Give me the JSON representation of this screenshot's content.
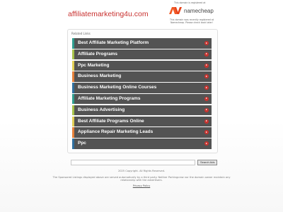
{
  "header": {
    "domain": "affiliatemarketing4u.com",
    "registrar_note": "This domain is registered at",
    "registrar_name": "namecheap",
    "registration_message": "This domain was recently registered at Namecheap. Please check back later!"
  },
  "related": {
    "label": "Related Links",
    "links": [
      {
        "label": "Best Affiliate Marketing Platform",
        "accent": "#2f9e8f"
      },
      {
        "label": "Affiliate Programs",
        "accent": "#a7c34a"
      },
      {
        "label": "Ppc Marketing",
        "accent": "#e1cf55"
      },
      {
        "label": "Business Marketing",
        "accent": "#e6813a"
      },
      {
        "label": "Business Marketing Online Courses",
        "accent": "#2f6f9e"
      },
      {
        "label": "Affiliate Marketing Programs",
        "accent": "#2f9e8f"
      },
      {
        "label": "Business Advertising",
        "accent": "#a7c34a"
      },
      {
        "label": "Best Affiliate Programs Online",
        "accent": "#e1cf55"
      },
      {
        "label": "Appliance Repair Marketing Leads",
        "accent": "#e6813a"
      },
      {
        "label": "Ppc",
        "accent": "#2f6f9e"
      }
    ]
  },
  "search": {
    "value": "",
    "button_label": "Search Ads"
  },
  "footer": {
    "copyright": "2025 Copyright. All Rights Reserved.",
    "disclaimer": "The Sponsored Listings displayed above are served automatically by a third party. Neither Parkingcrew nor the domain owner maintain any relationship with the advertisers.",
    "privacy": "Privacy Policy"
  },
  "colors": {
    "domain_red": "#c8312f",
    "row_bg": "#535353",
    "arrow_red": "#c9332f",
    "namecheap_orange": "#f15a24"
  },
  "icons": {
    "logo": "namecheap-logo-icon",
    "arrow": "arrow-right-circle-icon"
  }
}
